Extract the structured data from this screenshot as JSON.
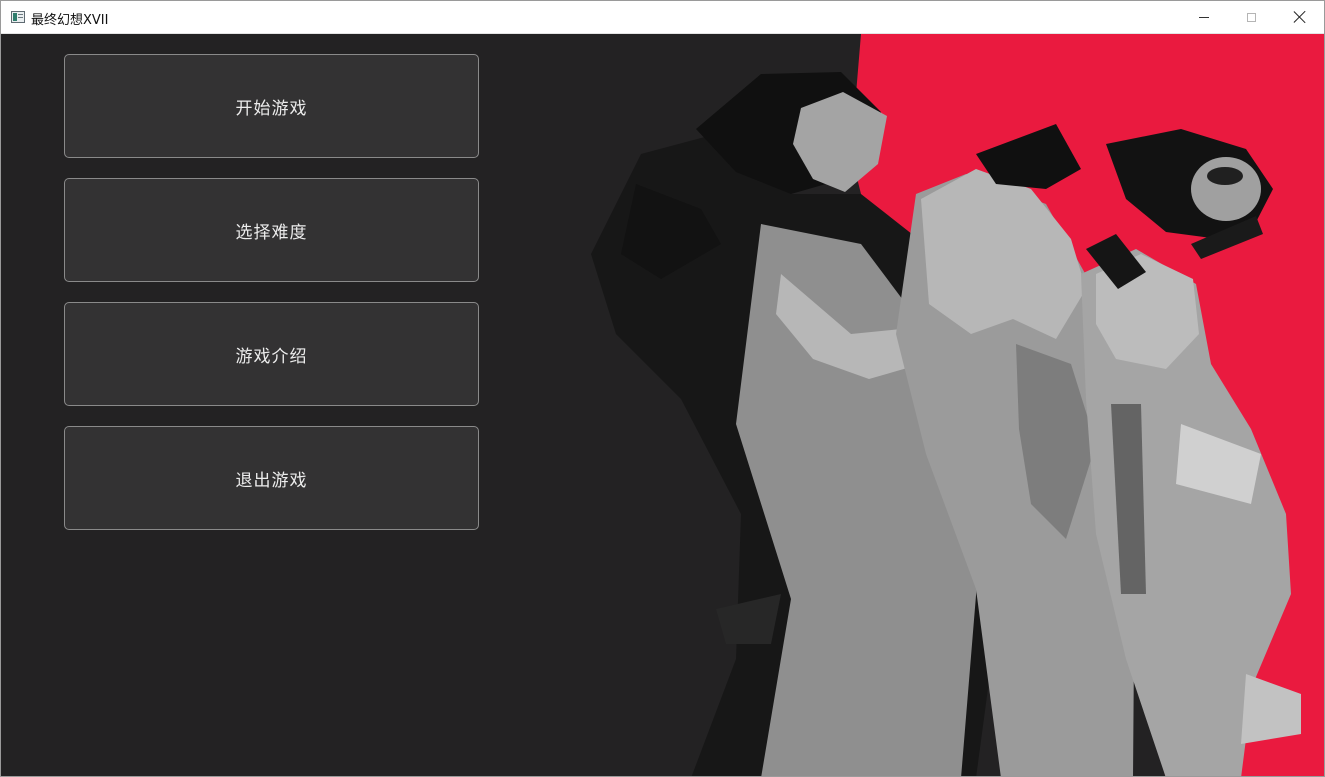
{
  "window": {
    "title": "最终幻想XVII",
    "icon": "app-window-icon",
    "controls": [
      "minimize-icon",
      "maximize-icon",
      "close-icon"
    ]
  },
  "menu": {
    "start_label": "开始游戏",
    "difficulty_label": "选择难度",
    "intro_label": "游戏介绍",
    "exit_label": "退出游戏"
  },
  "art": {
    "subject": "stylized-character-artwork",
    "background_color": "#ea1a3f",
    "figure_color": "#9e9e9e",
    "ink_color": "#1e1e1e"
  },
  "colors": {
    "panel_background": "#232223",
    "button_background": "#333233",
    "button_border": "#8a8a8a",
    "button_text": "#ececec"
  }
}
